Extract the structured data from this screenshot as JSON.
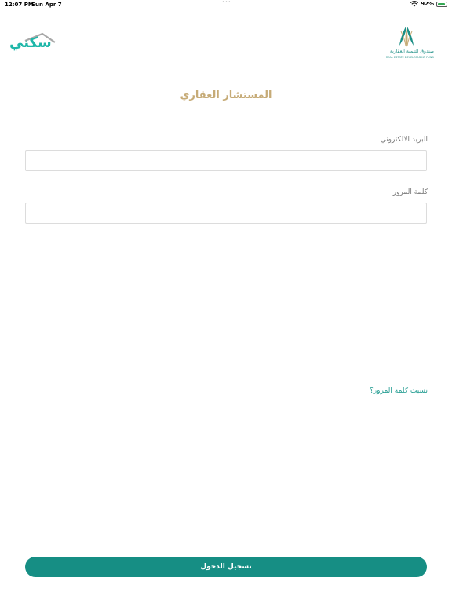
{
  "status_bar": {
    "time": "12:07 PM",
    "date": "Sun Apr 7",
    "battery_percent": "92%",
    "battery_level": 0.92,
    "icons": [
      "wifi-icon",
      "battery-icon"
    ]
  },
  "header": {
    "left_logo_text": "سكني",
    "right_logo_ar": "صندوق التنمية العقارية",
    "right_logo_en": "REAL ESTATE DEVELOPMENT FUND"
  },
  "page": {
    "title": "المستشار العقاري"
  },
  "form": {
    "email_label": "البريد الالكتروني",
    "email_value": "",
    "password_label": "كلمة المرور",
    "password_value": "",
    "forgot_password": "نسيت كلمة المرور؟",
    "login_button": "تسجيل الدخول"
  },
  "colors": {
    "accent": "#168e84",
    "title": "#c6ab77",
    "link": "#1e9a8f"
  }
}
